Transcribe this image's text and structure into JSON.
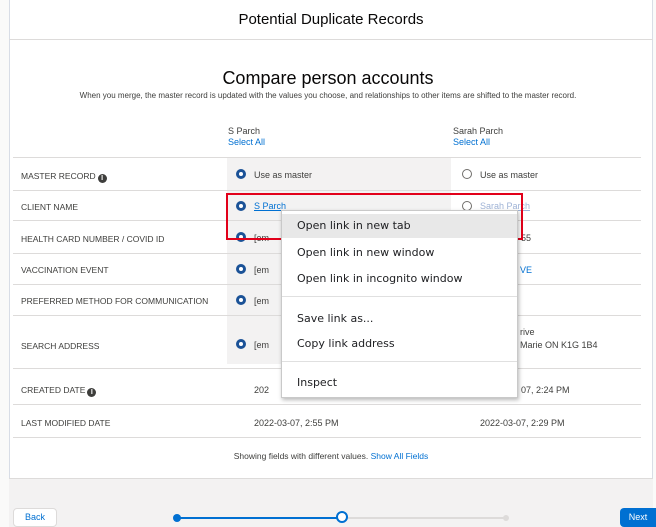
{
  "modal": {
    "title": "Potential Duplicate Records"
  },
  "compare": {
    "heading": "Compare person accounts",
    "subheading": "When you merge, the master record is updated with the values you choose, and relationships to other items are shifted to the master record."
  },
  "columns": [
    {
      "name": "S Parch",
      "select_all": "Select All"
    },
    {
      "name": "Sarah Parch",
      "select_all": "Select All"
    }
  ],
  "rows": {
    "master_record": {
      "label": "MASTER RECORD",
      "left": "Use as master",
      "right": "Use as master"
    },
    "client_name": {
      "label": "CLIENT NAME",
      "left": "S Parch",
      "right": "Sarah Parch"
    },
    "health_card": {
      "label": "HEALTH CARD NUMBER / COVID ID",
      "left": "[em",
      "right": "55"
    },
    "vaccination_event": {
      "label": "VACCINATION EVENT",
      "left": "[em",
      "right": "VE"
    },
    "preferred_method": {
      "label": "PREFERRED METHOD FOR COMMUNICATION",
      "left": "[em",
      "right": ""
    },
    "search_address": {
      "label": "SEARCH ADDRESS",
      "left": "[em",
      "right_line1": "rive",
      "right_line2": "Marie ON K1G 1B4"
    },
    "created_date": {
      "label": "CREATED DATE",
      "left": "202",
      "right": "07, 2:24 PM"
    },
    "last_modified": {
      "label": "LAST MODIFIED DATE",
      "left": "2022-03-07, 2:55 PM",
      "right": "2022-03-07, 2:29 PM"
    }
  },
  "footer": {
    "note": "Showing fields with different values.",
    "show_all": "Show All Fields",
    "back": "Back",
    "next": "Next"
  },
  "context_menu": {
    "items": [
      "Open link in new tab",
      "Open link in new window",
      "Open link in incognito window",
      "Save link as...",
      "Copy link address",
      "Inspect"
    ]
  },
  "icons": {
    "info": "info-icon"
  },
  "colors": {
    "brand": "#0070d2",
    "selected_radio": "#1b5297",
    "highlight": "#e2001a"
  }
}
